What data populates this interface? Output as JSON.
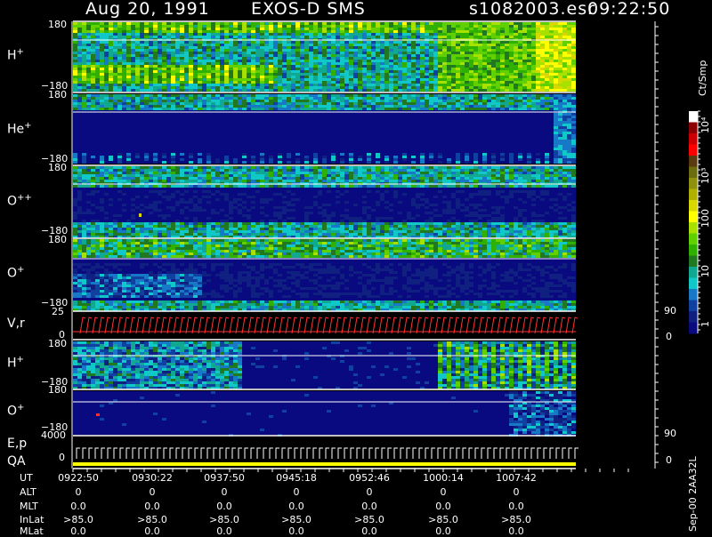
{
  "header": {
    "date": "Aug 20, 1991",
    "instrument": "EXOS-D SMS",
    "file": "s1082003.esr",
    "time": "09:22:50"
  },
  "panels": [
    {
      "label": "H",
      "sup": "+",
      "top_tick": "180",
      "bottom_tick": "−180"
    },
    {
      "label": "He",
      "sup": "+",
      "top_tick": "180",
      "bottom_tick": "−180"
    },
    {
      "label": "O",
      "sup": "++",
      "top_tick": "180",
      "bottom_tick": "−180"
    },
    {
      "label": "O",
      "sup": "+",
      "top_tick": "180",
      "bottom_tick": "−180"
    },
    {
      "label": "V,r",
      "sup": "",
      "top_tick": "25",
      "bottom_tick": "0",
      "right_top": "90",
      "right_bottom": "0"
    },
    {
      "label": "H",
      "sup": "+",
      "top_tick": "180",
      "bottom_tick": "−180"
    },
    {
      "label": "O",
      "sup": "+",
      "top_tick": "180",
      "bottom_tick": "−180"
    },
    {
      "label": "E,p",
      "label2": "QA",
      "sup": "",
      "top_tick": "4000",
      "bottom_tick": "0",
      "right_top": "90",
      "right_bottom": "0"
    }
  ],
  "colorbar": {
    "unit": "Ct/Smp",
    "labels": [
      "10⁴",
      "10³",
      "100",
      "10",
      "1"
    ],
    "colors": [
      "#ffffff",
      "#8b0000",
      "#cc0000",
      "#ff0000",
      "#5a3a10",
      "#6b6b10",
      "#8f8f10",
      "#b0b000",
      "#d8d800",
      "#ffff00",
      "#a8e000",
      "#60d000",
      "#30b000",
      "#207820",
      "#10a890",
      "#10c8c8",
      "#1878c8",
      "#1040a0",
      "#102080",
      "#0a0a80"
    ]
  },
  "footer": {
    "rows": [
      {
        "name": "UT",
        "values": [
          "0922:50",
          "0930:22",
          "0937:50",
          "0945:18",
          "0952:46",
          "1000:14",
          "1007:42"
        ]
      },
      {
        "name": "ALT",
        "values": [
          "0",
          "0",
          "0",
          "0",
          "0",
          "0",
          "0"
        ]
      },
      {
        "name": "MLT",
        "values": [
          "0.0",
          "0.0",
          "0.0",
          "0.0",
          "0.0",
          "0.0",
          "0.0"
        ]
      },
      {
        "name": "InLat",
        "values": [
          ">85.0",
          ">85.0",
          ">85.0",
          ">85.0",
          ">85.0",
          ">85.0",
          ">85.0"
        ]
      },
      {
        "name": "MLat",
        "values": [
          "0.0",
          "0.0",
          "0.0",
          "0.0",
          "0.0",
          "0.0",
          "0.0"
        ]
      }
    ],
    "stamp": "Sep-00  2AA32L"
  },
  "chart_data": {
    "type": "heatmap",
    "title": "Aug 20, 1991   EXOS-D SMS",
    "x_ticks": [
      "0922:50",
      "0930:22",
      "0937:50",
      "0945:18",
      "0952:46",
      "1000:14",
      "1007:42"
    ],
    "panels": [
      "H+",
      "He+",
      "O++",
      "O+",
      "V,r",
      "H+",
      "O+",
      "E,p QA"
    ],
    "colorbar_unit": "Ct/Smp",
    "colorbar_ticks": [
      "1",
      "10",
      "100",
      "10³",
      "10⁴"
    ]
  }
}
